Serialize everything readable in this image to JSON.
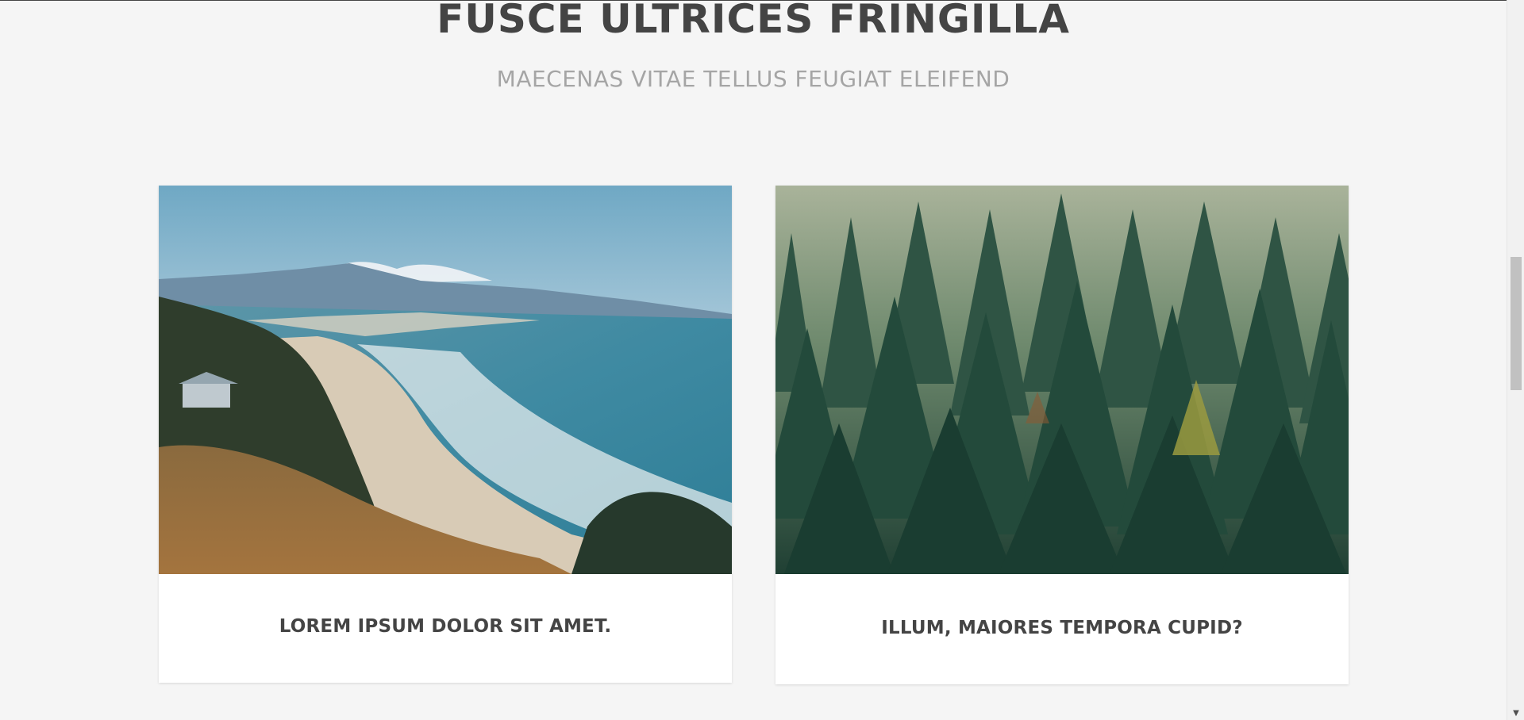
{
  "section": {
    "title": "FUSCE ULTRICES FRINGILLA",
    "subtitle": "MAECENAS VITAE TELLUS FEUGIAT ELEIFEND"
  },
  "cards": [
    {
      "caption": "LOREM IPSUM DOLOR SIT AMET.",
      "image": "coastline-beach-photo"
    },
    {
      "caption": "ILLUM, MAIORES TEMPORA CUPID?",
      "image": "pine-forest-photo"
    }
  ],
  "scrollbar": {
    "down_arrow": "▼"
  }
}
